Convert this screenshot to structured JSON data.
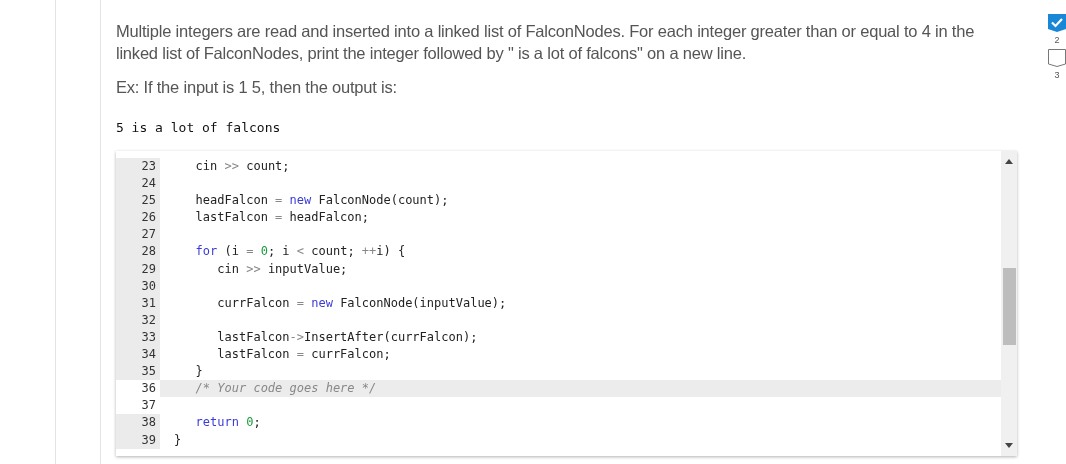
{
  "instructions": "Multiple integers are read and inserted into a linked list of FalconNodes. For each integer greater than or equal to 4 in the linked list of FalconNodes, print the integer followed by \" is a lot of falcons\" on a new line.",
  "example_intro": "Ex: If the input is 1 5, then the output is:",
  "example_output": "5 is a lot of falcons",
  "editor": {
    "lines": [
      {
        "number": "23",
        "selected": false,
        "current": false,
        "tokens": [
          {
            "kind": "text",
            "text": "   cin"
          },
          {
            "kind": "op",
            "text": " >> "
          },
          {
            "kind": "text",
            "text": "count;"
          }
        ]
      },
      {
        "number": "24",
        "selected": false,
        "current": false
      },
      {
        "number": "25",
        "selected": false,
        "current": false,
        "tokens": [
          {
            "kind": "text",
            "text": "   headFalcon"
          },
          {
            "kind": "op",
            "text": " = "
          },
          {
            "kind": "keyword",
            "text": "new "
          },
          {
            "kind": "text",
            "text": "FalconNode(count);"
          }
        ]
      },
      {
        "number": "26",
        "selected": false,
        "current": false,
        "tokens": [
          {
            "kind": "text",
            "text": "   lastFalcon"
          },
          {
            "kind": "op",
            "text": " = "
          },
          {
            "kind": "text",
            "text": "headFalcon;"
          }
        ]
      },
      {
        "number": "27",
        "selected": false,
        "current": false
      },
      {
        "number": "28",
        "selected": false,
        "current": false,
        "tokens": [
          {
            "kind": "keyword",
            "text": "   for "
          },
          {
            "kind": "text",
            "text": "(i"
          },
          {
            "kind": "op",
            "text": " = "
          },
          {
            "kind": "number",
            "text": "0"
          },
          {
            "kind": "text",
            "text": "; i"
          },
          {
            "kind": "op",
            "text": " < "
          },
          {
            "kind": "text",
            "text": "count; "
          },
          {
            "kind": "op",
            "text": "++"
          },
          {
            "kind": "text",
            "text": "i) {"
          }
        ]
      },
      {
        "number": "29",
        "selected": false,
        "current": false,
        "tokens": [
          {
            "kind": "text",
            "text": "      cin"
          },
          {
            "kind": "op",
            "text": " >> "
          },
          {
            "kind": "text",
            "text": "inputValue;"
          }
        ]
      },
      {
        "number": "30",
        "selected": false,
        "current": false
      },
      {
        "number": "31",
        "selected": false,
        "current": false,
        "tokens": [
          {
            "kind": "text",
            "text": "      currFalcon"
          },
          {
            "kind": "op",
            "text": " = "
          },
          {
            "kind": "keyword",
            "text": "new "
          },
          {
            "kind": "text",
            "text": "FalconNode(inputValue);"
          }
        ]
      },
      {
        "number": "32",
        "selected": false,
        "current": false
      },
      {
        "number": "33",
        "selected": false,
        "current": false,
        "tokens": [
          {
            "kind": "text",
            "text": "      lastFalcon"
          },
          {
            "kind": "op",
            "text": "->"
          },
          {
            "kind": "text",
            "text": "InsertAfter(currFalcon);"
          }
        ]
      },
      {
        "number": "34",
        "selected": false,
        "current": false,
        "tokens": [
          {
            "kind": "text",
            "text": "      lastFalcon"
          },
          {
            "kind": "op",
            "text": " = "
          },
          {
            "kind": "text",
            "text": "currFalcon;"
          }
        ]
      },
      {
        "number": "35",
        "selected": false,
        "current": false,
        "tokens": [
          {
            "kind": "text",
            "text": "   }"
          }
        ]
      },
      {
        "number": "36",
        "selected": true,
        "current": true,
        "tokens": [
          {
            "kind": "comment",
            "text": "   /* Your code goes here */"
          }
        ]
      },
      {
        "number": "37",
        "selected": true,
        "current": false
      },
      {
        "number": "38",
        "selected": false,
        "current": false,
        "tokens": [
          {
            "kind": "keyword",
            "text": "   return "
          },
          {
            "kind": "number",
            "text": "0"
          },
          {
            "kind": "text",
            "text": ";"
          }
        ]
      },
      {
        "number": "39",
        "selected": false,
        "current": false,
        "tokens": [
          {
            "kind": "text",
            "text": "}"
          }
        ]
      }
    ]
  },
  "progress": [
    {
      "label": "2",
      "checked": true
    },
    {
      "label": "3",
      "checked": false
    }
  ]
}
